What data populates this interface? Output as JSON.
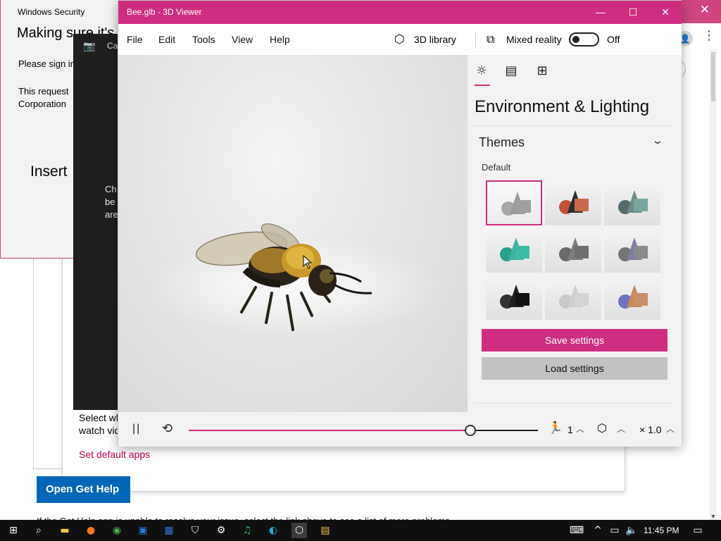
{
  "background": {
    "close_glyph": "✕",
    "avatar_glyph": "👤",
    "more_glyph": "⋮",
    "select_text_line1": "Select wh",
    "select_text_line2": "watch vid",
    "set_default_link": "Set default apps",
    "help_button": "Open Get Help",
    "bottom_text": "If the Get Help app is unable to resolve your issue, select the link above to see a list of more problems"
  },
  "security": {
    "title": "Windows Security",
    "heading": "Making sure it's you",
    "please": "Please sign in",
    "request_line1": "This request",
    "request_line2": "Corporation",
    "insert": "Insert"
  },
  "camera": {
    "title": "Camera",
    "text_line1": "Ch",
    "text_line2": "be",
    "text_line3": "are"
  },
  "viewer": {
    "title": "Bee.glb - 3D Viewer",
    "window_buttons": {
      "minimize": "—",
      "maximize": "☐",
      "close": "✕"
    },
    "menu": [
      "File",
      "Edit",
      "Tools",
      "View",
      "Help"
    ],
    "library_label": "3D library",
    "mixed_reality_label": "Mixed reality",
    "mixed_reality_state": "Off",
    "mixed_reality_on": false,
    "side_tabs": [
      {
        "icon": "sun-icon",
        "glyph": "☼"
      },
      {
        "icon": "stats-icon",
        "glyph": "▤"
      },
      {
        "icon": "grid-icon",
        "glyph": "⊞"
      }
    ],
    "panel_heading": "Environment & Lighting",
    "themes_label": "Themes",
    "themes_sub": "Default",
    "selected_theme": 0,
    "themes": [
      {
        "cone": "#9a9a9a",
        "sphere": "#a8a8a8",
        "box": "#9f9f9f"
      },
      {
        "cone": "#2b2b2b",
        "sphere": "#c0523a",
        "box": "#c96b4a"
      },
      {
        "cone": "#6e8b85",
        "sphere": "#556b6b",
        "box": "#7aa6a0"
      },
      {
        "cone": "#3bb3a0",
        "sphere": "#2aa08b",
        "box": "#3cbba5"
      },
      {
        "cone": "#7c7c7c",
        "sphere": "#6a6a6a",
        "box": "#6f6f6f"
      },
      {
        "cone": "#7b7ea0",
        "sphere": "#757575",
        "box": "#8a8a8a"
      },
      {
        "cone": "#1f1f1f",
        "sphere": "#333333",
        "box": "#111111"
      },
      {
        "cone": "#cfcfcf",
        "sphere": "#c9c9c9",
        "box": "#d3d3d3"
      },
      {
        "cone": "#c88a5a",
        "sphere": "#6e73c2",
        "box": "#c98f68"
      }
    ],
    "save_settings": "Save settings",
    "load_settings": "Load settings",
    "controls": {
      "progress": 0.806,
      "animation_count": "1",
      "speed": "× 1.0",
      "chevron_up": "︿"
    }
  },
  "taskbar": {
    "time": "11:45 PM",
    "icons": [
      "start-icon",
      "search-icon",
      "file-explorer-icon",
      "firefox-icon",
      "chrome-icon",
      "outlook-icon",
      "calculator-icon",
      "security-icon",
      "settings-icon",
      "media-icon",
      "edge-icon",
      "3d-viewer-icon",
      "store-icon"
    ]
  },
  "colors": {
    "accent": "#cf2e80",
    "taskbar": "#101010"
  }
}
